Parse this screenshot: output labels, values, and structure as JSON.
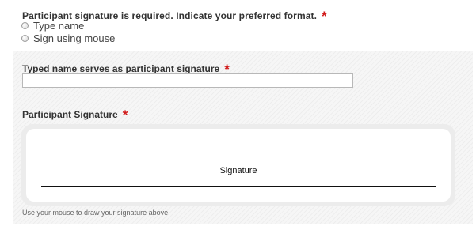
{
  "format_question": {
    "label": "Participant signature is required. Indicate your preferred format.",
    "required_marker": "*",
    "options": [
      {
        "label": "Type name",
        "selected": false
      },
      {
        "label": "Sign using mouse",
        "selected": false
      }
    ]
  },
  "typed_name": {
    "label": "Typed name serves as participant signature",
    "required_marker": "*",
    "value": ""
  },
  "signature_pad": {
    "label": "Participant Signature",
    "required_marker": "*",
    "pad_caption": "Signature",
    "help_text": "Use your mouse to draw your signature above"
  },
  "colors": {
    "required_marker": "#d11a1a",
    "panel_background": "#f6f6f6",
    "pad_border": "#ececec"
  }
}
